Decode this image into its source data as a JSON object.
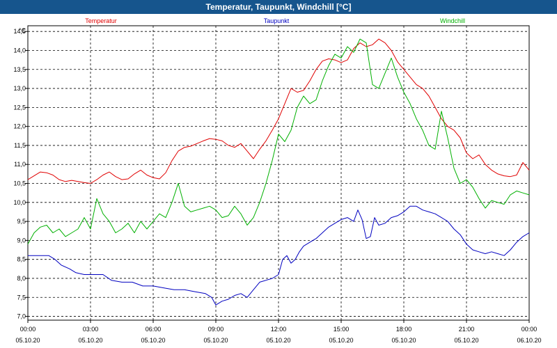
{
  "window": {
    "title": "Temperatur, Taupunkt, Windchill [°C]"
  },
  "chart_data": {
    "type": "line",
    "title": "Temperatur, Taupunkt, Windchill [°C]",
    "ylabel": "°C",
    "ylim": [
      6.9,
      14.65
    ],
    "yticks": [
      "14,5",
      "14,0",
      "13,5",
      "13,0",
      "12,5",
      "12,0",
      "11,5",
      "11,0",
      "10,5",
      "10,0",
      "9,5",
      "9,0",
      "8,5",
      "8,0",
      "7,5",
      "7,0"
    ],
    "ytick_values": [
      14.5,
      14.0,
      13.5,
      13.0,
      12.5,
      12.0,
      11.5,
      11.0,
      10.5,
      10.0,
      9.5,
      9.0,
      8.5,
      8.0,
      7.5,
      7.0
    ],
    "xlim": [
      0,
      24
    ],
    "xticks": [
      {
        "h": 0,
        "time": "00:00",
        "date": "05.10.20"
      },
      {
        "h": 3,
        "time": "03:00",
        "date": "05.10.20"
      },
      {
        "h": 6,
        "time": "06:00",
        "date": "05.10.20"
      },
      {
        "h": 9,
        "time": "09:00",
        "date": "05.10.20"
      },
      {
        "h": 12,
        "time": "12:00",
        "date": "05.10.20"
      },
      {
        "h": 15,
        "time": "15:00",
        "date": "05.10.20"
      },
      {
        "h": 18,
        "time": "18:00",
        "date": "05.10.20"
      },
      {
        "h": 21,
        "time": "21:00",
        "date": "05.10.20"
      },
      {
        "h": 24,
        "time": "00:00",
        "date": "06.10.20"
      }
    ],
    "grid": true,
    "legend_placement": "top",
    "series": [
      {
        "name": "Temperatur",
        "color": "#e00000",
        "x": [
          0,
          0.3,
          0.6,
          0.9,
          1.2,
          1.5,
          1.8,
          2.1,
          2.4,
          2.7,
          3.0,
          3.3,
          3.6,
          3.9,
          4.2,
          4.5,
          4.8,
          5.1,
          5.4,
          5.7,
          6.0,
          6.3,
          6.6,
          6.9,
          7.2,
          7.5,
          7.8,
          8.1,
          8.4,
          8.7,
          9.0,
          9.3,
          9.6,
          9.9,
          10.2,
          10.5,
          10.8,
          11.1,
          11.4,
          11.7,
          12.0,
          12.3,
          12.6,
          12.9,
          13.2,
          13.5,
          13.8,
          14.1,
          14.4,
          14.7,
          15.0,
          15.3,
          15.6,
          15.9,
          16.2,
          16.5,
          16.8,
          17.1,
          17.4,
          17.7,
          18.0,
          18.3,
          18.6,
          18.9,
          19.2,
          19.5,
          19.8,
          20.1,
          20.4,
          20.7,
          21.0,
          21.3,
          21.6,
          21.9,
          22.2,
          22.5,
          22.8,
          23.1,
          23.4,
          23.7,
          24.0
        ],
        "y": [
          10.6,
          10.7,
          10.8,
          10.78,
          10.72,
          10.6,
          10.55,
          10.58,
          10.55,
          10.52,
          10.5,
          10.6,
          10.72,
          10.8,
          10.68,
          10.6,
          10.62,
          10.75,
          10.85,
          10.72,
          10.65,
          10.62,
          10.78,
          11.1,
          11.35,
          11.45,
          11.48,
          11.55,
          11.62,
          11.68,
          11.66,
          11.62,
          11.5,
          11.45,
          11.55,
          11.35,
          11.15,
          11.4,
          11.62,
          11.9,
          12.2,
          12.6,
          13.0,
          12.9,
          12.95,
          13.2,
          13.5,
          13.72,
          13.78,
          13.75,
          13.68,
          13.75,
          14.05,
          14.2,
          14.1,
          14.15,
          14.3,
          14.2,
          14.0,
          13.7,
          13.5,
          13.3,
          13.1,
          13.0,
          12.8,
          12.5,
          12.2,
          12.0,
          11.9,
          11.7,
          11.3,
          11.15,
          11.25,
          11.0,
          10.85,
          10.75,
          10.7,
          10.68,
          10.72,
          11.05,
          10.85
        ]
      },
      {
        "name": "Taupunkt",
        "color": "#0000c0",
        "x": [
          0,
          0.5,
          1.0,
          1.3,
          1.6,
          2.0,
          2.3,
          2.7,
          3.0,
          3.3,
          3.6,
          4.0,
          4.5,
          5.0,
          5.5,
          6.0,
          6.5,
          7.0,
          7.5,
          8.0,
          8.5,
          8.8,
          9.0,
          9.3,
          9.6,
          9.9,
          10.2,
          10.5,
          10.8,
          11.1,
          11.4,
          11.7,
          12.0,
          12.2,
          12.4,
          12.6,
          12.8,
          13.0,
          13.2,
          13.5,
          13.8,
          14.1,
          14.4,
          14.7,
          15.0,
          15.3,
          15.6,
          15.8,
          16.0,
          16.2,
          16.4,
          16.6,
          16.8,
          17.1,
          17.4,
          17.7,
          18.0,
          18.3,
          18.6,
          18.9,
          19.2,
          19.5,
          19.8,
          20.1,
          20.4,
          20.7,
          21.0,
          21.3,
          21.6,
          21.9,
          22.2,
          22.5,
          22.8,
          23.1,
          23.4,
          23.7,
          24.0
        ],
        "y": [
          8.6,
          8.6,
          8.6,
          8.5,
          8.35,
          8.25,
          8.15,
          8.1,
          8.1,
          8.1,
          8.1,
          7.95,
          7.9,
          7.9,
          7.8,
          7.8,
          7.75,
          7.7,
          7.7,
          7.65,
          7.6,
          7.5,
          7.3,
          7.4,
          7.45,
          7.55,
          7.6,
          7.5,
          7.7,
          7.9,
          7.95,
          8.0,
          8.1,
          8.5,
          8.6,
          8.4,
          8.5,
          8.7,
          8.85,
          8.95,
          9.05,
          9.2,
          9.35,
          9.45,
          9.55,
          9.6,
          9.5,
          9.8,
          9.55,
          9.05,
          9.1,
          9.6,
          9.4,
          9.45,
          9.6,
          9.65,
          9.75,
          9.9,
          9.9,
          9.8,
          9.75,
          9.7,
          9.6,
          9.5,
          9.3,
          9.15,
          8.9,
          8.75,
          8.7,
          8.65,
          8.7,
          8.65,
          8.6,
          8.75,
          8.95,
          9.1,
          9.2
        ]
      },
      {
        "name": "Windchill",
        "color": "#00b000",
        "x": [
          0,
          0.3,
          0.6,
          0.9,
          1.2,
          1.5,
          1.8,
          2.1,
          2.4,
          2.7,
          3.0,
          3.3,
          3.6,
          3.9,
          4.2,
          4.5,
          4.8,
          5.1,
          5.4,
          5.7,
          6.0,
          6.3,
          6.6,
          6.9,
          7.2,
          7.5,
          7.8,
          8.1,
          8.4,
          8.7,
          9.0,
          9.3,
          9.6,
          9.9,
          10.2,
          10.5,
          10.8,
          11.1,
          11.4,
          11.7,
          12.0,
          12.3,
          12.6,
          12.9,
          13.2,
          13.5,
          13.8,
          14.1,
          14.4,
          14.7,
          15.0,
          15.3,
          15.6,
          15.9,
          16.2,
          16.5,
          16.8,
          17.1,
          17.4,
          17.7,
          18.0,
          18.3,
          18.6,
          18.9,
          19.2,
          19.5,
          19.8,
          20.1,
          20.4,
          20.7,
          21.0,
          21.3,
          21.6,
          21.9,
          22.2,
          22.5,
          22.8,
          23.1,
          23.4,
          23.7,
          24.0
        ],
        "y": [
          8.9,
          9.2,
          9.35,
          9.4,
          9.2,
          9.3,
          9.1,
          9.2,
          9.3,
          9.6,
          9.3,
          10.1,
          9.7,
          9.5,
          9.2,
          9.3,
          9.45,
          9.2,
          9.5,
          9.3,
          9.5,
          9.7,
          9.6,
          10.0,
          10.5,
          9.9,
          9.75,
          9.8,
          9.85,
          9.9,
          9.8,
          9.6,
          9.65,
          9.9,
          9.7,
          9.4,
          9.6,
          10.0,
          10.5,
          11.1,
          11.8,
          11.6,
          11.9,
          12.5,
          12.8,
          12.6,
          12.7,
          13.2,
          13.6,
          13.9,
          13.8,
          14.1,
          13.95,
          14.3,
          14.2,
          13.1,
          13.0,
          13.4,
          13.8,
          13.3,
          12.9,
          12.6,
          12.2,
          11.9,
          11.5,
          11.4,
          12.4,
          11.7,
          10.9,
          10.5,
          10.6,
          10.4,
          10.1,
          9.85,
          10.05,
          10.0,
          9.95,
          10.2,
          10.3,
          10.25,
          10.2
        ]
      }
    ]
  }
}
